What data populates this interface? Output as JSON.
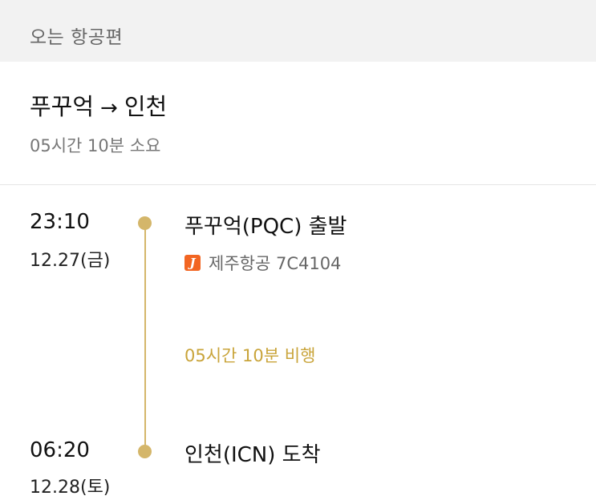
{
  "header": {
    "title": "오는 항공편"
  },
  "route": {
    "origin": "푸꾸억",
    "arrow": "→",
    "destination": "인천",
    "total_duration": "05시간 10분 소요"
  },
  "departure": {
    "time": "23:10",
    "date": "12.27(금)",
    "airport": "푸꾸억(PQC) 출발"
  },
  "airline": {
    "logo_letter": "J",
    "name": "제주항공 7C4104",
    "logo_color": "#f26522"
  },
  "flight_time": "05시간 10분 비행",
  "arrival": {
    "time": "06:20",
    "date": "12.28(토)",
    "airport": "인천(ICN) 도착"
  },
  "colors": {
    "accent_gold": "#c9a43a",
    "timeline": "#d4b66a",
    "header_bg": "#f2f2f2"
  }
}
